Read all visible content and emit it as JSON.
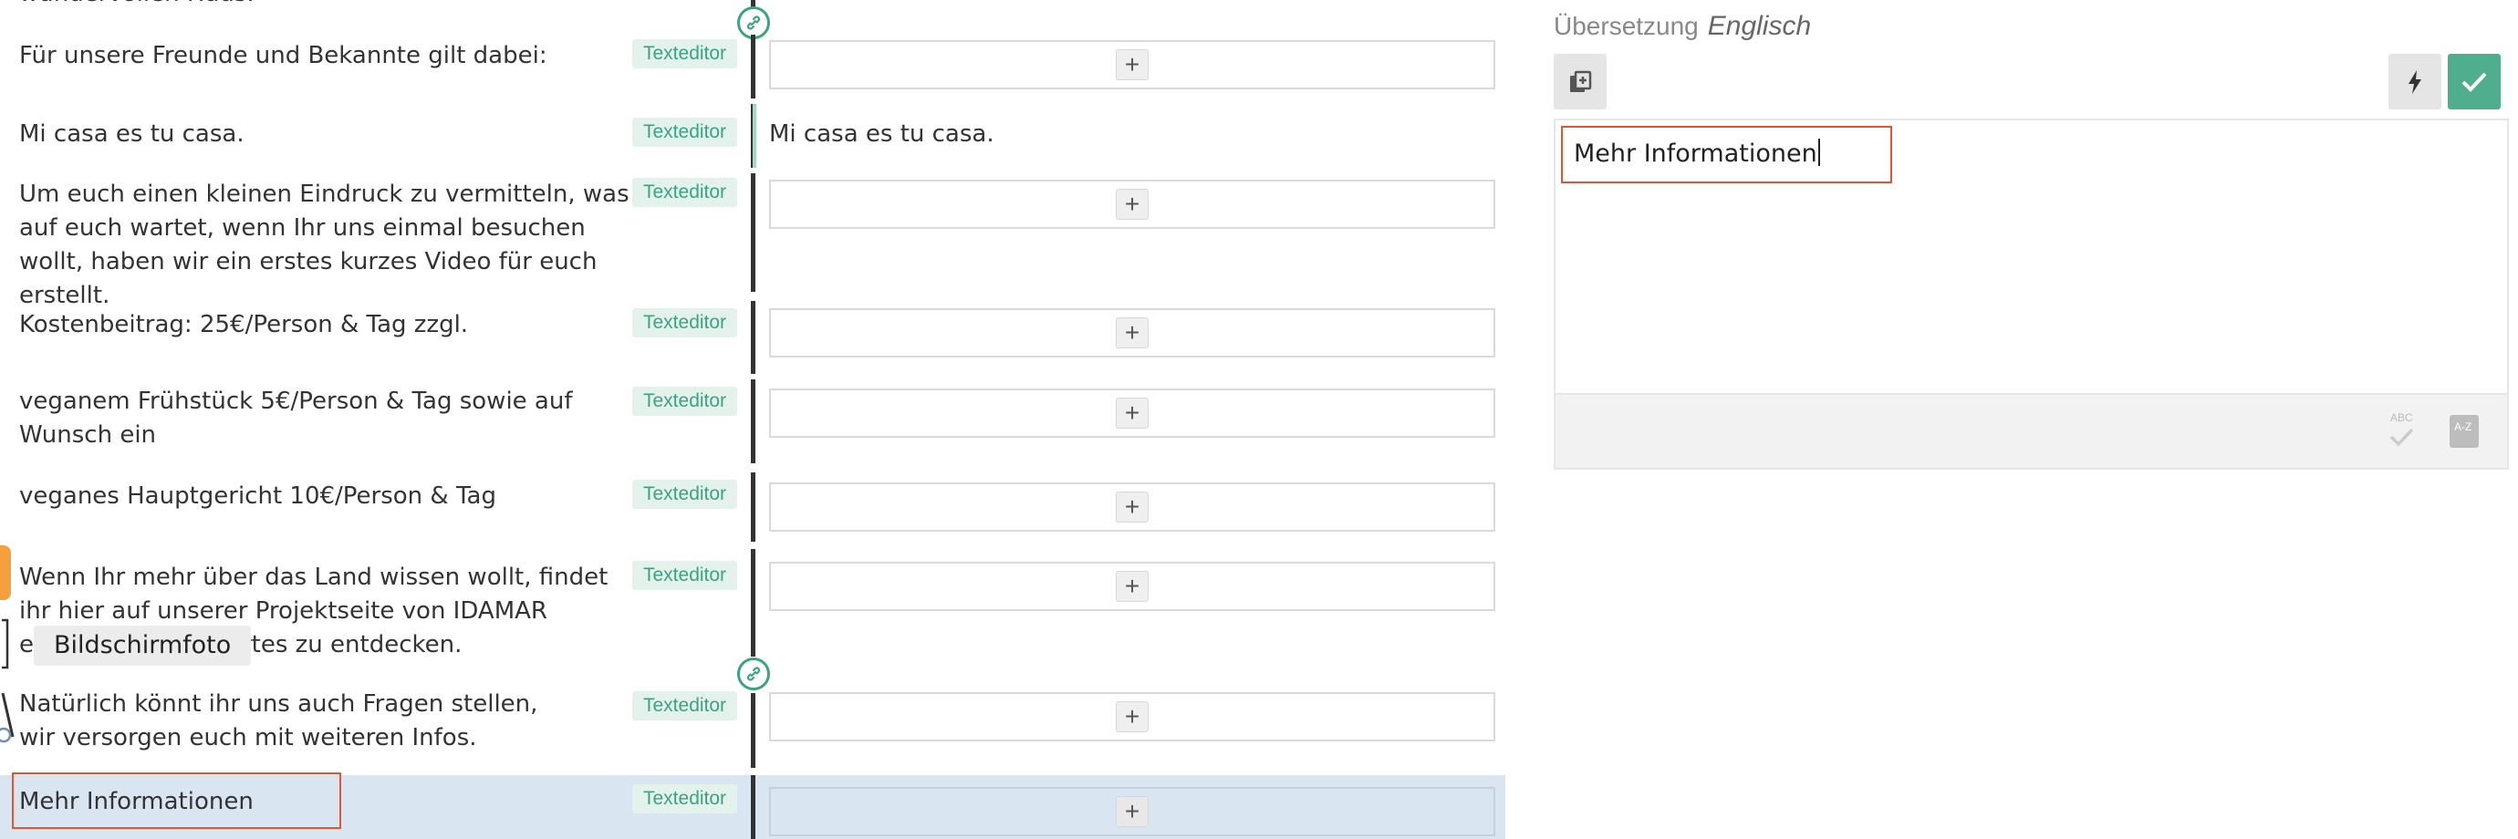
{
  "top_partial_text": "wundervollen Haus.",
  "tag_label": "Texteditor",
  "plus_label": "+",
  "rows": [
    {
      "source": "Für unsere Freunde und Bekannte gilt dabei:"
    },
    {
      "source": "Mi casa es tu casa.",
      "target": "Mi casa es tu casa."
    },
    {
      "source": "Um euch einen kleinen Eindruck zu vermitteln, was auf euch wartet, wenn Ihr uns einmal besuchen wollt, haben wir ein erstes kurzes Video für euch erstellt."
    },
    {
      "source": "Kostenbeitrag: 25€/Person & Tag zzgl."
    },
    {
      "source": "veganem Frühstück 5€/Person & Tag sowie auf Wunsch ein"
    },
    {
      "source": "veganes Hauptgericht 10€/Person & Tag"
    },
    {
      "source": "Wenn Ihr mehr über das Land wissen wollt, findet ihr hier auf unserer Projektseite von IDAMAR einiges Wissenswertes zu entdecken."
    },
    {
      "source": "Natürlich könnt ihr uns auch Fragen stellen, wir versorgen euch mit weiteren Infos."
    },
    {
      "source": "Mehr Informationen"
    }
  ],
  "tooltip": "Bildschirmfoto",
  "panel": {
    "label": "Übersetzung",
    "language": "Englisch",
    "editor_value": "Mehr Informationen",
    "foot_abc": "ABC",
    "foot_az": "A-Z"
  },
  "colors": {
    "accent_green": "#3aa382",
    "confirm_green": "#4fae8e",
    "highlight_outline": "#e4542f",
    "selected_row": "#dae5f2"
  }
}
